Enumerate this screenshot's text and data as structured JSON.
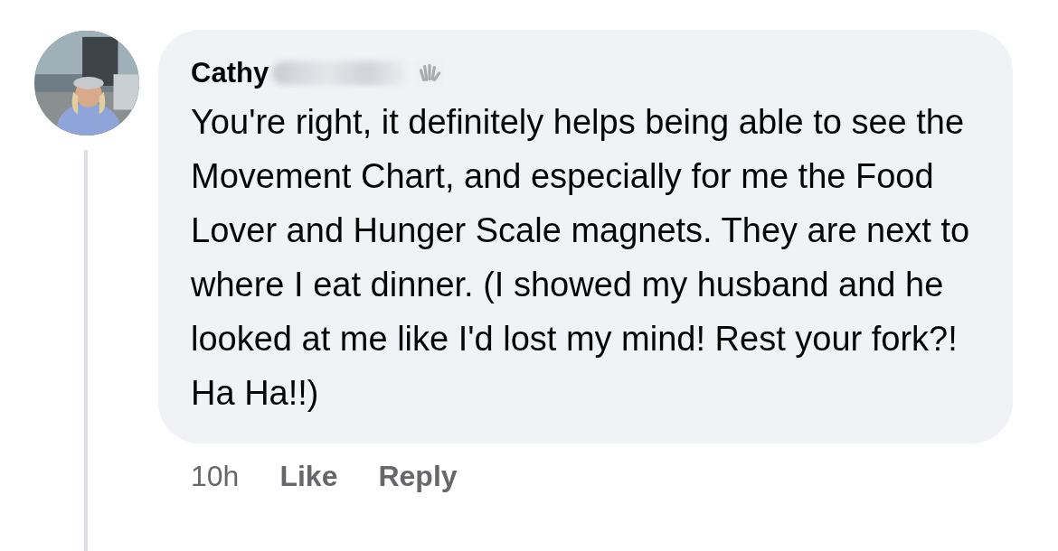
{
  "comment": {
    "author": "Cathy",
    "author_redacted": true,
    "text": "You're right, it definitely helps being able to see the Movement Chart, and especially for me the Food Lover and Hunger Scale magnets. They are next to where I eat dinner. (I showed my husband and he looked at me like I'd lost my mind! Rest your fork?! Ha Ha!!)",
    "time": "10h",
    "actions": [
      "Like",
      "Reply"
    ]
  }
}
